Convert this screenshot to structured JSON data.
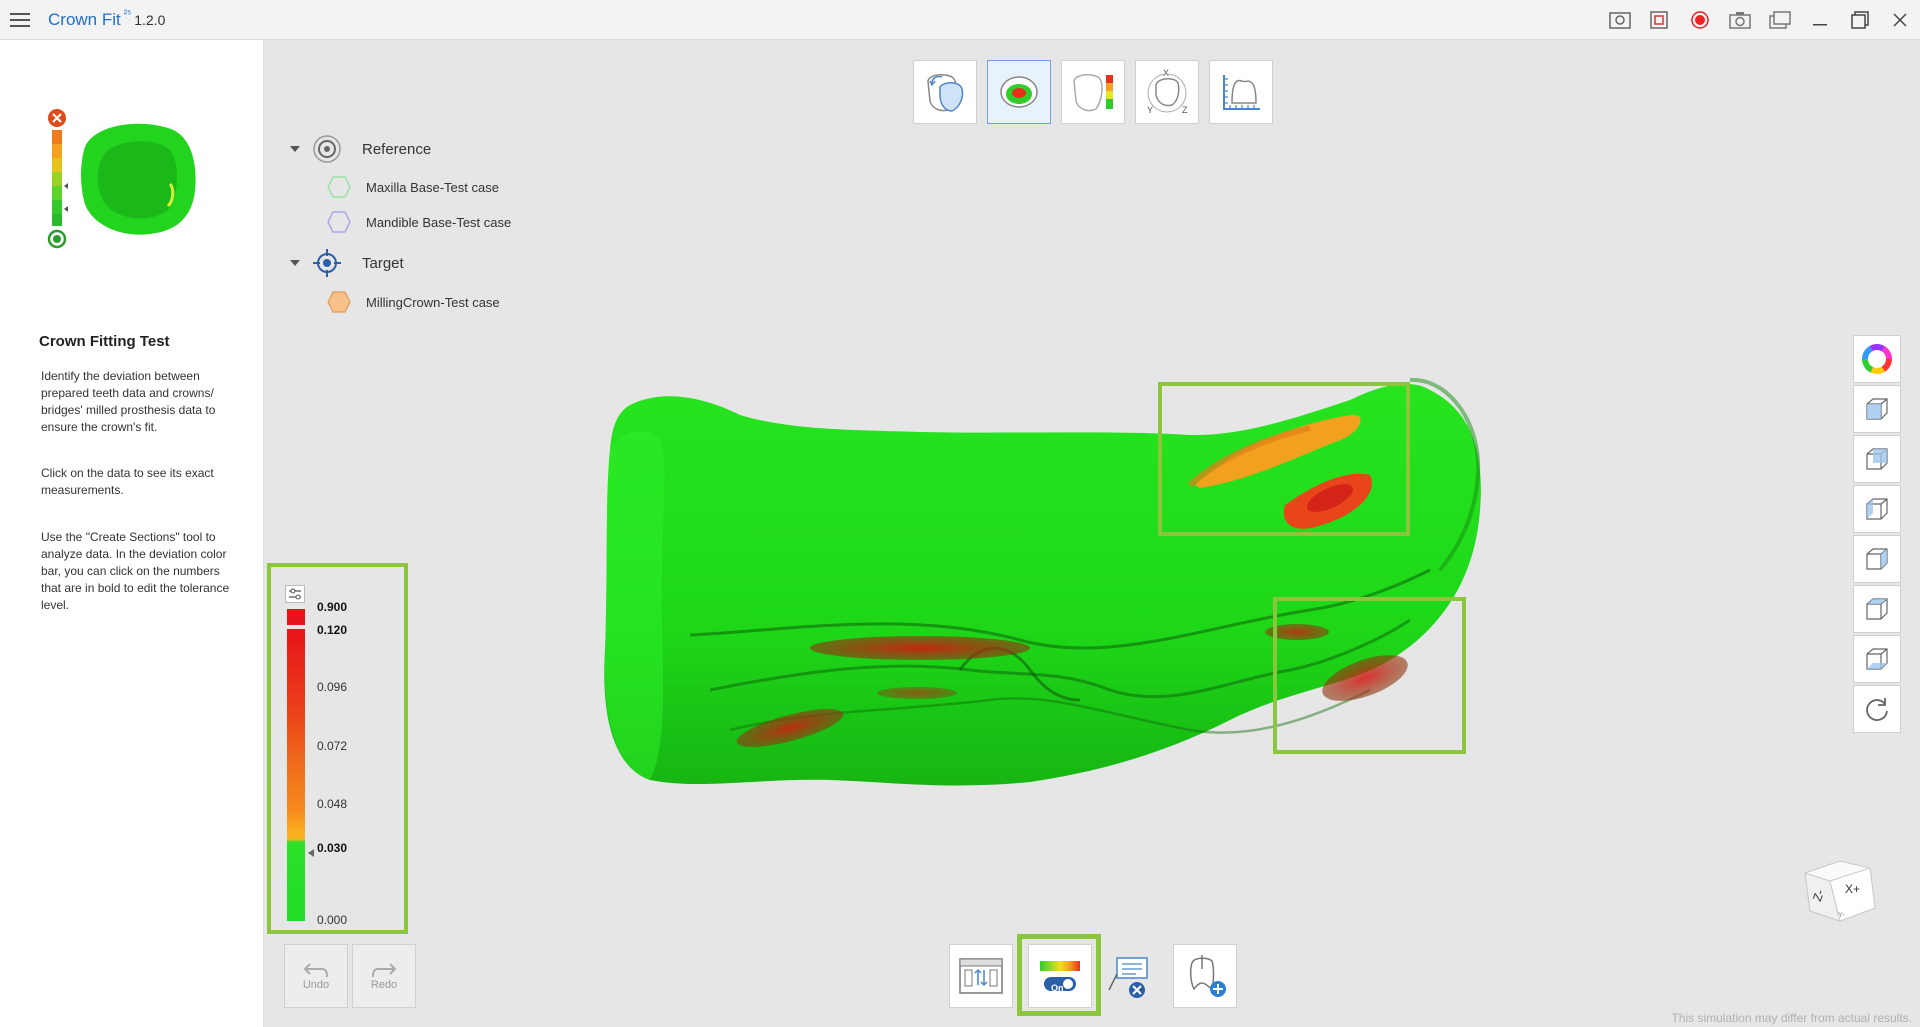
{
  "app": {
    "name": "Crown Fit",
    "badge": "²⁵",
    "version": "1.2.0"
  },
  "titlebar_icons": [
    "capture-screen-icon",
    "crop-record-icon",
    "record-icon",
    "camera-icon",
    "gallery-icon",
    "minimize-icon",
    "maximize-icon",
    "close-icon"
  ],
  "panel": {
    "title": "Crown Fitting Test",
    "p1": "Identify the deviation between prepared teeth data and crowns/ bridges' milled prosthesis data to ensure the crown's fit.",
    "p2": "Click on the data to see its exact measurements.",
    "p3": "Use the \"Create Sections\" tool to analyze data. In the deviation color bar, you can click on the numbers that are in bold to edit the tolerance level."
  },
  "tree": {
    "reference": {
      "label": "Reference",
      "items": [
        "Maxilla Base-Test case",
        "Mandible Base-Test case"
      ]
    },
    "target": {
      "label": "Target",
      "items": [
        "MillingCrown-Test case"
      ]
    }
  },
  "deviation": {
    "labels": [
      "0.900",
      "0.120",
      "0.096",
      "0.072",
      "0.048",
      "0.030",
      "0.000"
    ],
    "bold": [
      true,
      true,
      false,
      false,
      false,
      true,
      false
    ]
  },
  "undo": {
    "label": "Undo"
  },
  "redo": {
    "label": "Redo"
  },
  "bottom": {
    "toggle_label": "On"
  },
  "footer": "This simulation may differ from actual results.",
  "colors": {
    "accent": "#1f6fd1",
    "highlight": "#8cc63f",
    "green": "#22dd22",
    "red": "#e8141a"
  }
}
